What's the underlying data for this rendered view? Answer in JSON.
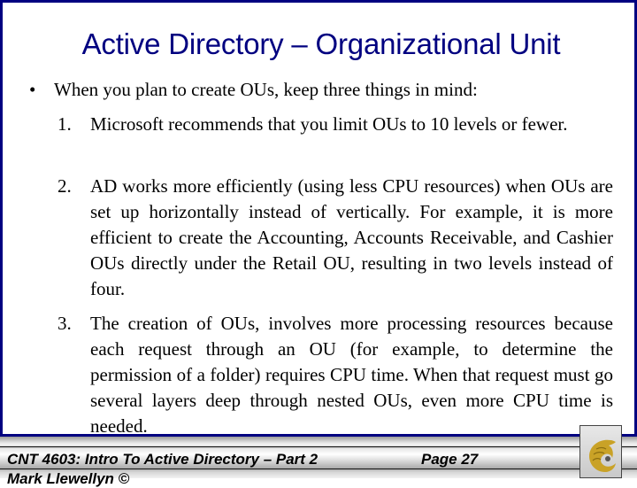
{
  "slide": {
    "title": "Active Directory – Organizational Unit",
    "bullet": {
      "marker": "•",
      "text": "When you plan to create OUs, keep three things in mind:"
    },
    "items": [
      {
        "number": "1.",
        "text": "Microsoft recommends that you limit OUs to 10 levels or fewer."
      },
      {
        "number": "2.",
        "text": "AD works more efficiently (using less CPU resources) when OUs are set up horizontally instead of vertically.  For example, it is more efficient to create the Accounting, Accounts Receivable, and Cashier OUs directly under the Retail OU, resulting in two levels instead of four."
      },
      {
        "number": "3.",
        "text": "The creation of OUs, involves more processing resources because each request through an OU (for example, to determine the permission of a folder) requires CPU time.  When that request must go several layers deep through nested OUs, even more CPU time is needed."
      }
    ]
  },
  "footer": {
    "course": "CNT 4603: Intro To Active Directory – Part 2",
    "page": "Page 27",
    "author": "Mark Llewellyn ©",
    "logo": "pegasus-logo-icon"
  },
  "colors": {
    "title": "#000080",
    "border": "#000080",
    "logo_gold": "#c9a227"
  }
}
